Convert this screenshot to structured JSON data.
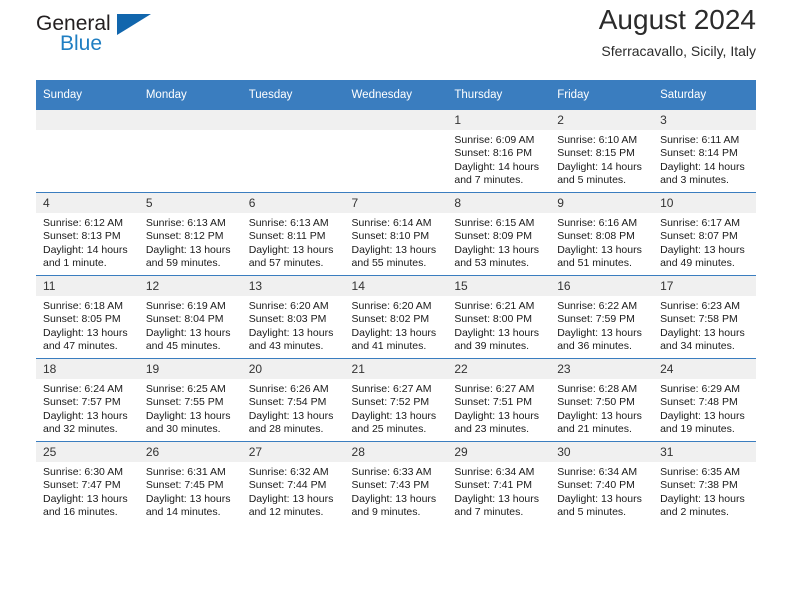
{
  "brand": {
    "name_top": "General",
    "name_bottom": "Blue",
    "triangle_color": "#1166ad",
    "blue_color": "#1f7ec2"
  },
  "header": {
    "title": "August 2024",
    "subtitle": "Sferracavallo, Sicily, Italy",
    "header_bg": "#3a7dbf",
    "daynum_bg": "#f0f0f0"
  },
  "weekday_headers": [
    "Sunday",
    "Monday",
    "Tuesday",
    "Wednesday",
    "Thursday",
    "Friday",
    "Saturday"
  ],
  "labels": {
    "sunrise": "Sunrise:",
    "sunset": "Sunset:",
    "daylight": "Daylight:"
  },
  "weeks": [
    [
      {
        "day": "",
        "empty": true
      },
      {
        "day": "",
        "empty": true
      },
      {
        "day": "",
        "empty": true
      },
      {
        "day": "",
        "empty": true
      },
      {
        "day": "1",
        "sunrise": "Sunrise: 6:09 AM",
        "sunset": "Sunset: 8:16 PM",
        "daylight_line1": "Daylight: 14 hours",
        "daylight_line2": "and 7 minutes."
      },
      {
        "day": "2",
        "sunrise": "Sunrise: 6:10 AM",
        "sunset": "Sunset: 8:15 PM",
        "daylight_line1": "Daylight: 14 hours",
        "daylight_line2": "and 5 minutes."
      },
      {
        "day": "3",
        "sunrise": "Sunrise: 6:11 AM",
        "sunset": "Sunset: 8:14 PM",
        "daylight_line1": "Daylight: 14 hours",
        "daylight_line2": "and 3 minutes."
      }
    ],
    [
      {
        "day": "4",
        "sunrise": "Sunrise: 6:12 AM",
        "sunset": "Sunset: 8:13 PM",
        "daylight_line1": "Daylight: 14 hours",
        "daylight_line2": "and 1 minute."
      },
      {
        "day": "5",
        "sunrise": "Sunrise: 6:13 AM",
        "sunset": "Sunset: 8:12 PM",
        "daylight_line1": "Daylight: 13 hours",
        "daylight_line2": "and 59 minutes."
      },
      {
        "day": "6",
        "sunrise": "Sunrise: 6:13 AM",
        "sunset": "Sunset: 8:11 PM",
        "daylight_line1": "Daylight: 13 hours",
        "daylight_line2": "and 57 minutes."
      },
      {
        "day": "7",
        "sunrise": "Sunrise: 6:14 AM",
        "sunset": "Sunset: 8:10 PM",
        "daylight_line1": "Daylight: 13 hours",
        "daylight_line2": "and 55 minutes."
      },
      {
        "day": "8",
        "sunrise": "Sunrise: 6:15 AM",
        "sunset": "Sunset: 8:09 PM",
        "daylight_line1": "Daylight: 13 hours",
        "daylight_line2": "and 53 minutes."
      },
      {
        "day": "9",
        "sunrise": "Sunrise: 6:16 AM",
        "sunset": "Sunset: 8:08 PM",
        "daylight_line1": "Daylight: 13 hours",
        "daylight_line2": "and 51 minutes."
      },
      {
        "day": "10",
        "sunrise": "Sunrise: 6:17 AM",
        "sunset": "Sunset: 8:07 PM",
        "daylight_line1": "Daylight: 13 hours",
        "daylight_line2": "and 49 minutes."
      }
    ],
    [
      {
        "day": "11",
        "sunrise": "Sunrise: 6:18 AM",
        "sunset": "Sunset: 8:05 PM",
        "daylight_line1": "Daylight: 13 hours",
        "daylight_line2": "and 47 minutes."
      },
      {
        "day": "12",
        "sunrise": "Sunrise: 6:19 AM",
        "sunset": "Sunset: 8:04 PM",
        "daylight_line1": "Daylight: 13 hours",
        "daylight_line2": "and 45 minutes."
      },
      {
        "day": "13",
        "sunrise": "Sunrise: 6:20 AM",
        "sunset": "Sunset: 8:03 PM",
        "daylight_line1": "Daylight: 13 hours",
        "daylight_line2": "and 43 minutes."
      },
      {
        "day": "14",
        "sunrise": "Sunrise: 6:20 AM",
        "sunset": "Sunset: 8:02 PM",
        "daylight_line1": "Daylight: 13 hours",
        "daylight_line2": "and 41 minutes."
      },
      {
        "day": "15",
        "sunrise": "Sunrise: 6:21 AM",
        "sunset": "Sunset: 8:00 PM",
        "daylight_line1": "Daylight: 13 hours",
        "daylight_line2": "and 39 minutes."
      },
      {
        "day": "16",
        "sunrise": "Sunrise: 6:22 AM",
        "sunset": "Sunset: 7:59 PM",
        "daylight_line1": "Daylight: 13 hours",
        "daylight_line2": "and 36 minutes."
      },
      {
        "day": "17",
        "sunrise": "Sunrise: 6:23 AM",
        "sunset": "Sunset: 7:58 PM",
        "daylight_line1": "Daylight: 13 hours",
        "daylight_line2": "and 34 minutes."
      }
    ],
    [
      {
        "day": "18",
        "sunrise": "Sunrise: 6:24 AM",
        "sunset": "Sunset: 7:57 PM",
        "daylight_line1": "Daylight: 13 hours",
        "daylight_line2": "and 32 minutes."
      },
      {
        "day": "19",
        "sunrise": "Sunrise: 6:25 AM",
        "sunset": "Sunset: 7:55 PM",
        "daylight_line1": "Daylight: 13 hours",
        "daylight_line2": "and 30 minutes."
      },
      {
        "day": "20",
        "sunrise": "Sunrise: 6:26 AM",
        "sunset": "Sunset: 7:54 PM",
        "daylight_line1": "Daylight: 13 hours",
        "daylight_line2": "and 28 minutes."
      },
      {
        "day": "21",
        "sunrise": "Sunrise: 6:27 AM",
        "sunset": "Sunset: 7:52 PM",
        "daylight_line1": "Daylight: 13 hours",
        "daylight_line2": "and 25 minutes."
      },
      {
        "day": "22",
        "sunrise": "Sunrise: 6:27 AM",
        "sunset": "Sunset: 7:51 PM",
        "daylight_line1": "Daylight: 13 hours",
        "daylight_line2": "and 23 minutes."
      },
      {
        "day": "23",
        "sunrise": "Sunrise: 6:28 AM",
        "sunset": "Sunset: 7:50 PM",
        "daylight_line1": "Daylight: 13 hours",
        "daylight_line2": "and 21 minutes."
      },
      {
        "day": "24",
        "sunrise": "Sunrise: 6:29 AM",
        "sunset": "Sunset: 7:48 PM",
        "daylight_line1": "Daylight: 13 hours",
        "daylight_line2": "and 19 minutes."
      }
    ],
    [
      {
        "day": "25",
        "sunrise": "Sunrise: 6:30 AM",
        "sunset": "Sunset: 7:47 PM",
        "daylight_line1": "Daylight: 13 hours",
        "daylight_line2": "and 16 minutes."
      },
      {
        "day": "26",
        "sunrise": "Sunrise: 6:31 AM",
        "sunset": "Sunset: 7:45 PM",
        "daylight_line1": "Daylight: 13 hours",
        "daylight_line2": "and 14 minutes."
      },
      {
        "day": "27",
        "sunrise": "Sunrise: 6:32 AM",
        "sunset": "Sunset: 7:44 PM",
        "daylight_line1": "Daylight: 13 hours",
        "daylight_line2": "and 12 minutes."
      },
      {
        "day": "28",
        "sunrise": "Sunrise: 6:33 AM",
        "sunset": "Sunset: 7:43 PM",
        "daylight_line1": "Daylight: 13 hours",
        "daylight_line2": "and 9 minutes."
      },
      {
        "day": "29",
        "sunrise": "Sunrise: 6:34 AM",
        "sunset": "Sunset: 7:41 PM",
        "daylight_line1": "Daylight: 13 hours",
        "daylight_line2": "and 7 minutes."
      },
      {
        "day": "30",
        "sunrise": "Sunrise: 6:34 AM",
        "sunset": "Sunset: 7:40 PM",
        "daylight_line1": "Daylight: 13 hours",
        "daylight_line2": "and 5 minutes."
      },
      {
        "day": "31",
        "sunrise": "Sunrise: 6:35 AM",
        "sunset": "Sunset: 7:38 PM",
        "daylight_line1": "Daylight: 13 hours",
        "daylight_line2": "and 2 minutes."
      }
    ]
  ]
}
